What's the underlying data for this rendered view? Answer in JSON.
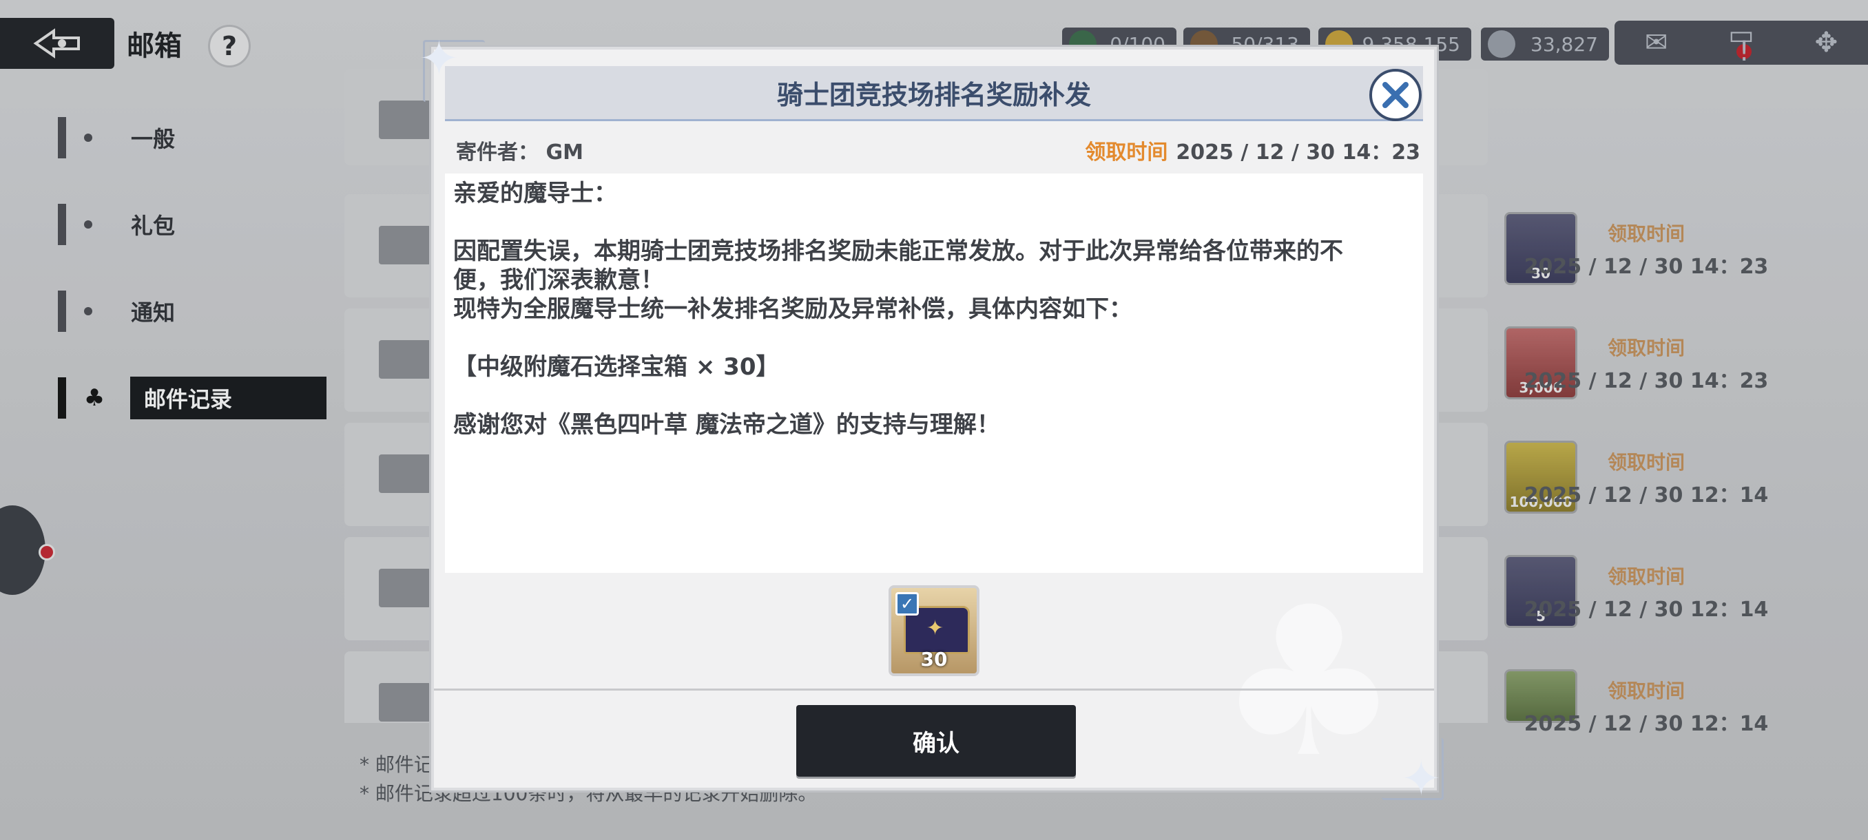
{
  "header": {
    "title": "邮箱",
    "help_label": "?",
    "resources": [
      {
        "value": "0/100",
        "icon": "stamina-icon",
        "color": "#3b6b4a"
      },
      {
        "value": "50/313",
        "icon": "ticket-icon",
        "color": "#7a5a3a"
      },
      {
        "value": "9,358,155",
        "icon": "gold-coin-icon",
        "color": "#c9a23a"
      },
      {
        "value": "33,827",
        "icon": "crystal-drop-icon",
        "color": "#9aa0aa"
      }
    ],
    "icons": [
      "mail-icon",
      "chat-icon",
      "menu-emblem-icon"
    ],
    "chat_badge": "!"
  },
  "sidebar": {
    "items": [
      {
        "label": "一般"
      },
      {
        "label": "礼包"
      },
      {
        "label": "通知"
      },
      {
        "label": "邮件记录",
        "active": true
      }
    ]
  },
  "mail_list": {
    "rows": [
      {
        "time_label": "领取时间",
        "time": "2025 / 12 / 30 14：23",
        "item_qty": "30",
        "item": "treasure-chest-icon"
      },
      {
        "time_label": "领取时间",
        "time": "2025 / 12 / 30 14：23",
        "item_qty": "3,000",
        "item": "red-crystal-icon"
      },
      {
        "time_label": "领取时间",
        "time": "2025 / 12 / 30 12：14",
        "item_qty": "100,000",
        "item": "gold-coin-icon"
      },
      {
        "time_label": "领取时间",
        "time": "2025 / 12 / 30 12：14",
        "item_qty": "5",
        "item": "mystery-chest-icon"
      },
      {
        "time_label": "领取时间",
        "time": "2025 / 12 / 30 12：14",
        "item_qty": "",
        "item": "clover-token-icon"
      }
    ],
    "footer_notes": [
      "* 邮件记",
      "* 邮件记录超过100条时，将从最早的记录开始删除。"
    ]
  },
  "dialog": {
    "title": "骑士团竞技场排名奖励补发",
    "sender_label": "寄件者：",
    "sender": "GM",
    "time_label": "领取时间",
    "time": "2025 / 12 / 30 14：23",
    "body_lines": [
      "亲爱的魔导士：",
      "",
      "因配置失误，本期骑士团竞技场排名奖励未能正常发放。对于此次异常给各位带来的不",
      "便，我们深表歉意！",
      "现特为全服魔导士统一补发排名奖励及异常补偿，具体内容如下：",
      "",
      "【中级附魔石选择宝箱 × 30】",
      "",
      "感谢您对《黑色四叶草 魔法帝之道》的支持与理解！"
    ],
    "reward": {
      "qty": "30",
      "icon": "treasure-chest-icon",
      "checked": true
    },
    "confirm_label": "确认"
  }
}
